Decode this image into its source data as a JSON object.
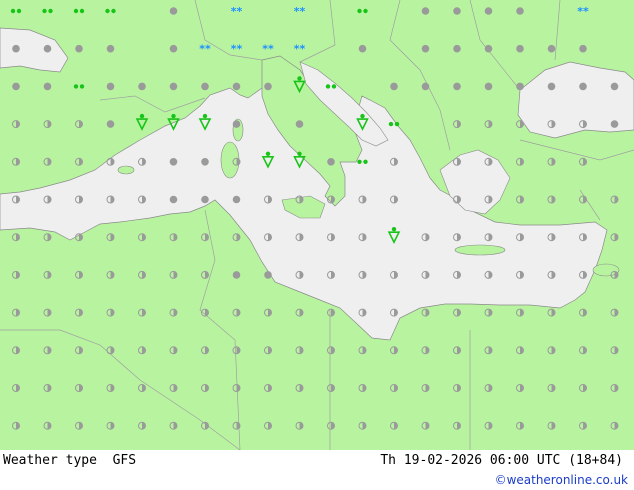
{
  "footer": {
    "title_left": "Weather type  GFS",
    "title_right": "Th 19-02-2026 06:00 UTC (18+84)",
    "credit": "©weatheronline.co.uk"
  },
  "colors": {
    "land": "#b8f4a0",
    "sea": "#efefef",
    "border": "#a8a8a8",
    "cloud_grey": "#9a9a9a",
    "rain_green": "#18c418",
    "snow_blue": "#1e90ff"
  },
  "symbol_types": {
    "c": "cloudy-dot",
    "o": "light-cloud-circle",
    "d": "drizzle",
    "r": "rain-shower",
    "s": "snow",
    "x": "heavy-snow",
    "t": "thunder-shower"
  },
  "grid": [
    "dddd.c.x.s.d.cccc.s.s.s.s",
    "cccc.cssss.c.cccccc......",
    "ccdccccccrd.ccccccccccc.r",
    "ooocrrrc.c.rd.oooooc.....",
    "oooooccorrcdo.ooooo.ooo..",
    "ooooocccooooo.ooooooooooo",
    "oooooooooooorooooooooooo.",
    "oooooooccoooooooooooooo.r",
    "oooooooooooooooooooooooor",
    "ooooooooooooooooooooooooo",
    "ooooooooooooooooooooooooo",
    "ooooooooooooooooooooooooo"
  ]
}
